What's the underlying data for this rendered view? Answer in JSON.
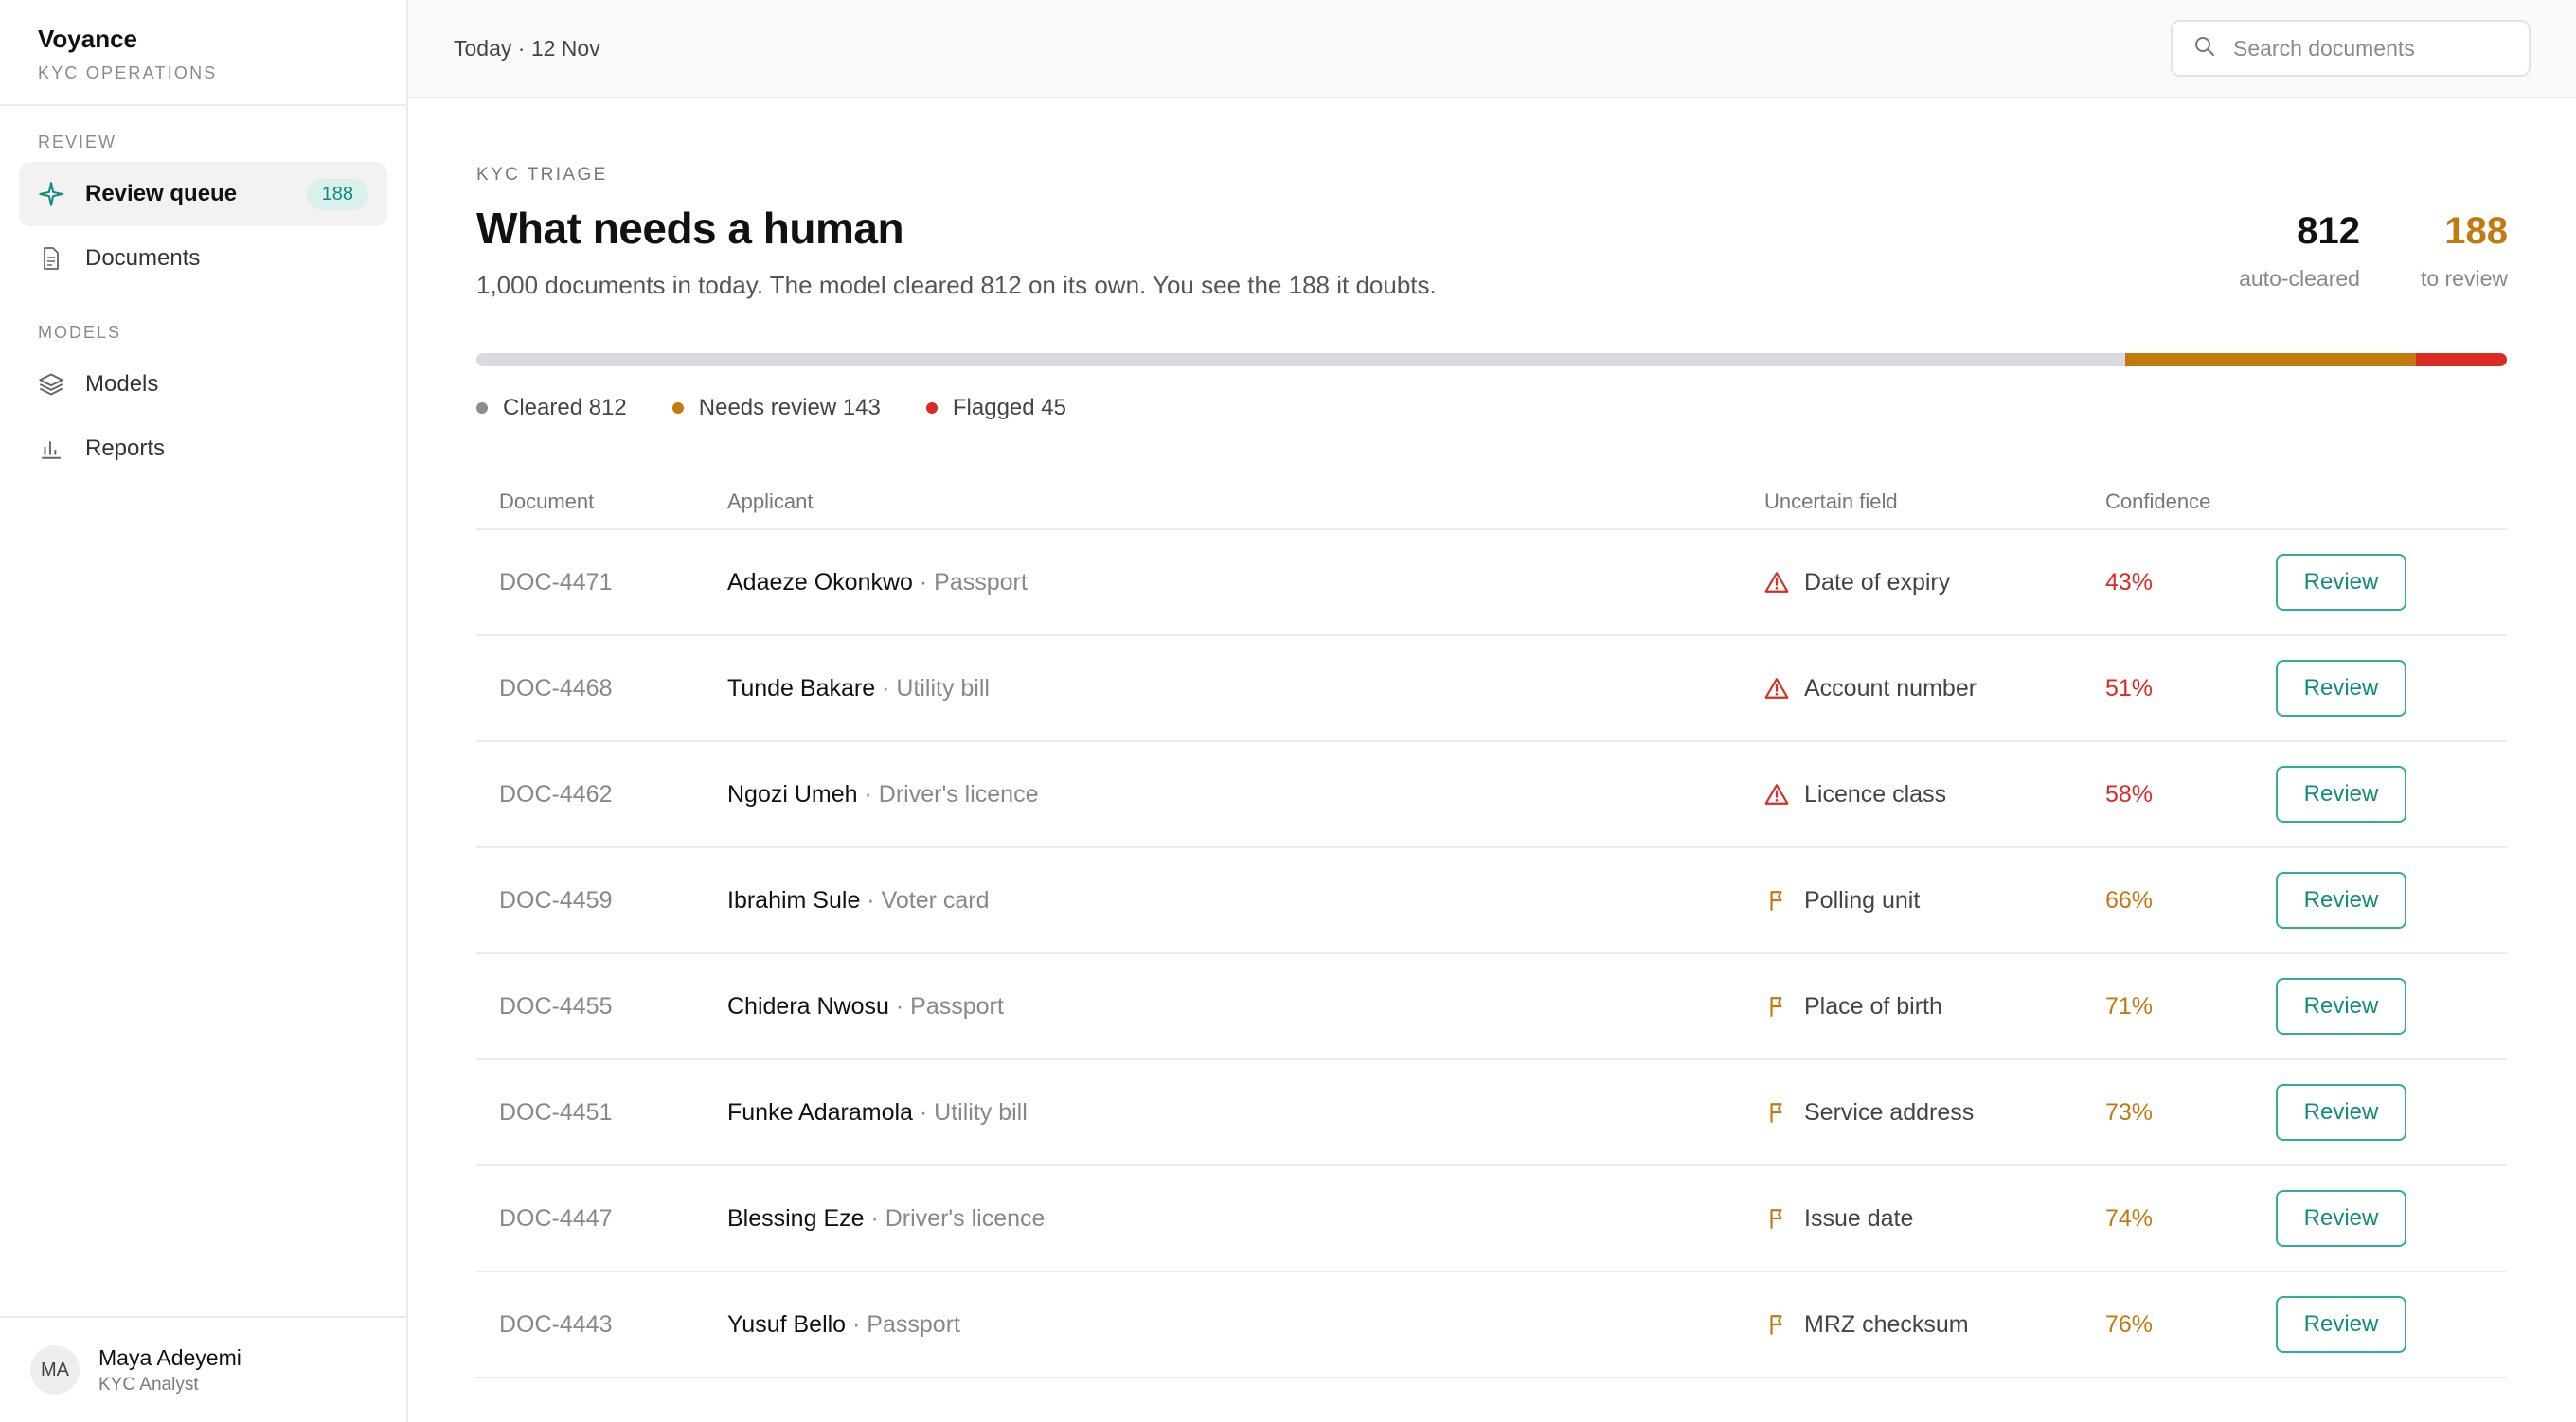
{
  "brand": {
    "name": "Voyance",
    "subtitle": "KYC OPERATIONS"
  },
  "nav": {
    "review_section": "REVIEW",
    "models_section": "MODELS",
    "items": [
      {
        "label": "Review queue",
        "icon": "sparkle-icon",
        "badge": "188",
        "active": true
      },
      {
        "label": "Documents",
        "icon": "document-icon"
      },
      {
        "label": "Models",
        "icon": "layers-icon"
      },
      {
        "label": "Reports",
        "icon": "bar-chart-icon"
      }
    ]
  },
  "user": {
    "initials": "MA",
    "name": "Maya Adeyemi",
    "role": "KYC Analyst"
  },
  "topbar": {
    "date": "Today · 12 Nov",
    "search_placeholder": "Search documents"
  },
  "header": {
    "eyebrow": "KYC TRIAGE",
    "title": "What needs a human",
    "subtitle": "1,000 documents in today. The model cleared 812 on its own. You see the 188 it doubts."
  },
  "stats": [
    {
      "value": "812",
      "label": "auto-cleared",
      "color": "#111111"
    },
    {
      "value": "188",
      "label": "to review",
      "color": "#c27a0e"
    }
  ],
  "progress": {
    "total": 1000,
    "segments": [
      {
        "name": "Cleared",
        "count": 812,
        "color": "#d9dbe0",
        "legend": "Cleared 812",
        "dot": "#8c8c8c"
      },
      {
        "name": "Needs review",
        "count": 143,
        "color": "#c27a0e",
        "legend": "Needs review 143",
        "dot": "#c27a0e"
      },
      {
        "name": "Flagged",
        "count": 45,
        "color": "#dc2a24",
        "legend": "Flagged 45",
        "dot": "#dc2a24"
      }
    ]
  },
  "table": {
    "headers": {
      "document": "Document",
      "applicant": "Applicant",
      "field": "Uncertain field",
      "confidence": "Confidence"
    },
    "review_label": "Review",
    "rows": [
      {
        "doc": "DOC-4471",
        "name": "Adaeze Okonkwo",
        "type": " · Passport",
        "field": "Date of expiry",
        "confidence": "43%",
        "level": "flagged"
      },
      {
        "doc": "DOC-4468",
        "name": "Tunde Bakare",
        "type": " · Utility bill",
        "field": "Account number",
        "confidence": "51%",
        "level": "flagged"
      },
      {
        "doc": "DOC-4462",
        "name": "Ngozi Umeh",
        "type": " · Driver's licence",
        "field": "Licence class",
        "confidence": "58%",
        "level": "flagged"
      },
      {
        "doc": "DOC-4459",
        "name": "Ibrahim Sule",
        "type": " · Voter card",
        "field": "Polling unit",
        "confidence": "66%",
        "level": "review"
      },
      {
        "doc": "DOC-4455",
        "name": "Chidera Nwosu",
        "type": " · Passport",
        "field": "Place of birth",
        "confidence": "71%",
        "level": "review"
      },
      {
        "doc": "DOC-4451",
        "name": "Funke Adaramola",
        "type": " · Utility bill",
        "field": "Service address",
        "confidence": "73%",
        "level": "review"
      },
      {
        "doc": "DOC-4447",
        "name": "Blessing Eze",
        "type": " · Driver's licence",
        "field": "Issue date",
        "confidence": "74%",
        "level": "review"
      },
      {
        "doc": "DOC-4443",
        "name": "Yusuf Bello",
        "type": " · Passport",
        "field": "MRZ checksum",
        "confidence": "76%",
        "level": "review"
      }
    ]
  },
  "colors": {
    "flagged": "#dc2a24",
    "review": "#c27a0e",
    "accent": "#128c7c"
  }
}
